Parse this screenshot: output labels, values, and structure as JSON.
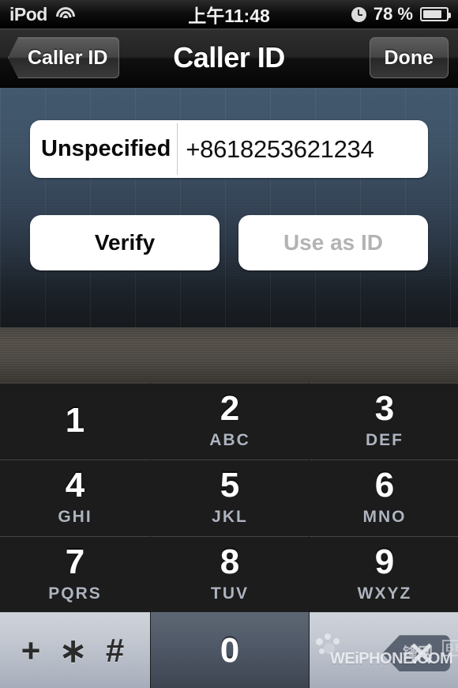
{
  "status_bar": {
    "carrier": "iPod",
    "wifi_icon": "wifi-icon",
    "time": "上午11:48",
    "clock_icon": "clock-icon",
    "battery_percent": "78 %",
    "battery_icon": "battery-icon"
  },
  "nav_bar": {
    "back_label": "Caller ID",
    "title": "Caller ID",
    "done_label": "Done"
  },
  "form": {
    "field_label": "Unspecified",
    "field_value": "+8618253621234",
    "verify_label": "Verify",
    "use_as_id_label": "Use as ID"
  },
  "keypad": {
    "keys": [
      {
        "num": "1",
        "letters": ""
      },
      {
        "num": "2",
        "letters": "ABC"
      },
      {
        "num": "3",
        "letters": "DEF"
      },
      {
        "num": "4",
        "letters": "GHI"
      },
      {
        "num": "5",
        "letters": "JKL"
      },
      {
        "num": "6",
        "letters": "MNO"
      },
      {
        "num": "7",
        "letters": "PQRS"
      },
      {
        "num": "8",
        "letters": "TUV"
      },
      {
        "num": "9",
        "letters": "WXYZ"
      }
    ],
    "symbol_key": "+ ∗ #",
    "zero_key": "0",
    "delete_icon": "delete-backspace-icon"
  },
  "watermark": {
    "site": "WEiPHONE.COM",
    "cn": "锋网",
    "bbs": "BBS"
  },
  "colors": {
    "wallpaper_top": "#435a70",
    "wallpaper_bottom": "#15181c",
    "key_top": "#7b8598",
    "key_bottom": "#49515f",
    "field_bg": "#ffffff",
    "disabled_text": "#b3b3b3"
  }
}
